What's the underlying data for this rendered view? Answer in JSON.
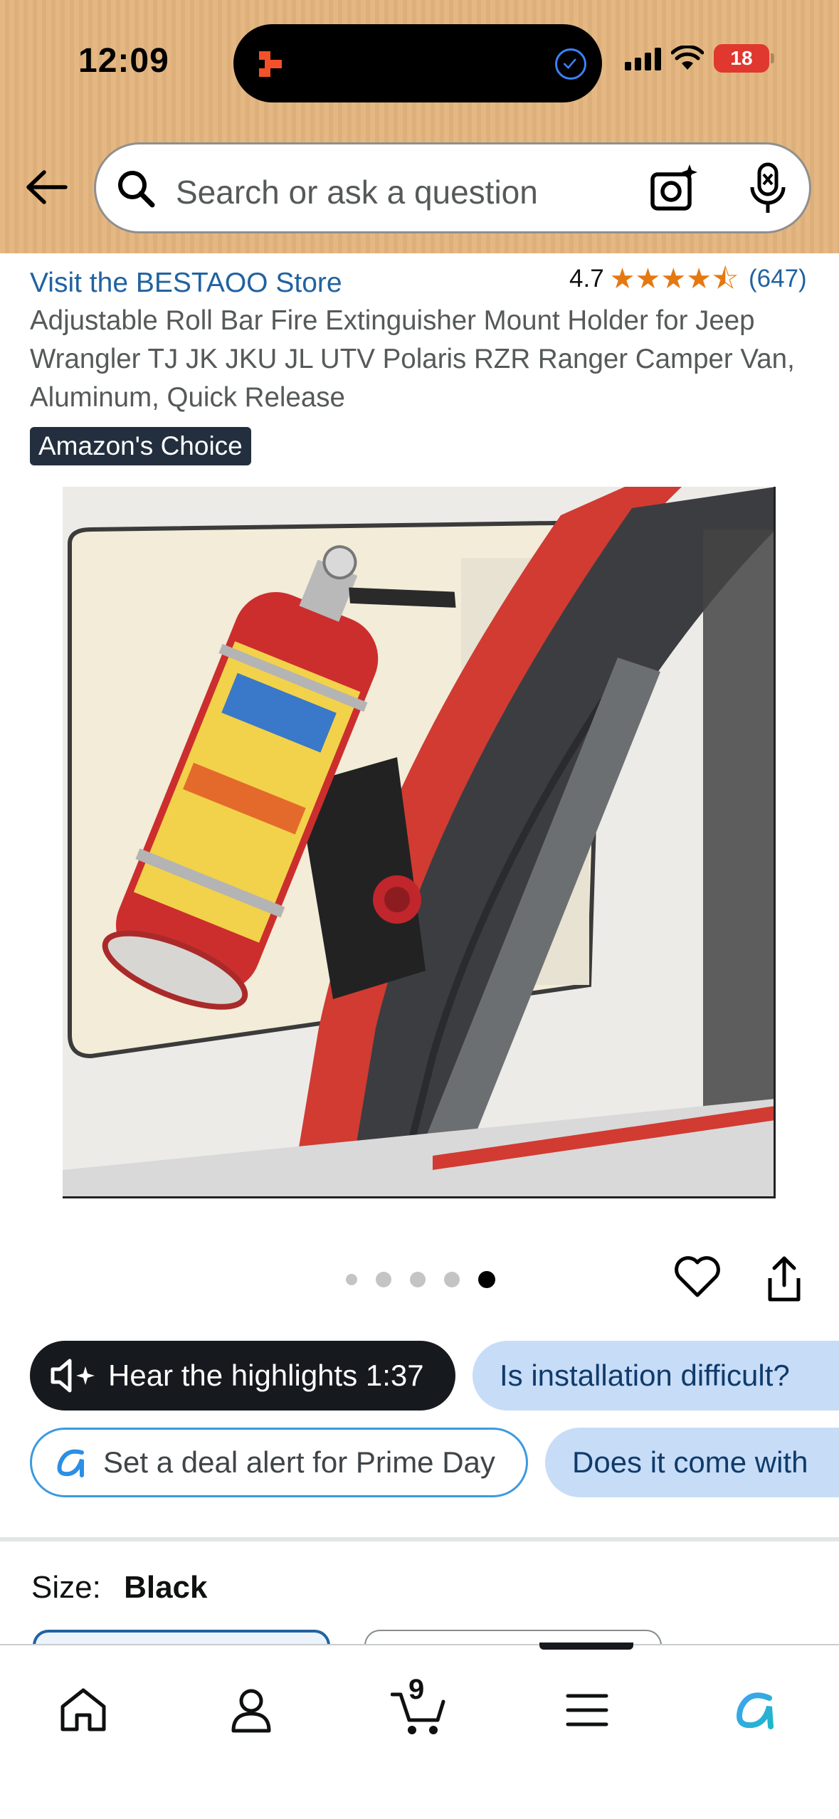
{
  "status_bar": {
    "time": "12:09",
    "battery": "18",
    "icons": [
      "app-indicator-icon",
      "check-circle-icon",
      "cellular-signal-icon",
      "wifi-icon",
      "battery-icon"
    ]
  },
  "header": {
    "back_icon": "arrow-left-icon",
    "search": {
      "placeholder": "Search or ask a question",
      "icons": [
        "search-icon",
        "camera-sparkle-icon",
        "microphone-icon"
      ]
    },
    "colors": {
      "background": "#e5b883",
      "border": "#8f8f8f"
    }
  },
  "product": {
    "store_link": "Visit the BESTAOO Store",
    "rating": "4.7",
    "stars": "★★★★⯪",
    "rating_count": "(647)",
    "title": "Adjustable Roll Bar Fire Extinguisher Mount Holder for Jeep Wrangler TJ JK JKU JL UTV Polaris RZR Ranger Camper Van, Aluminum, Quick Release",
    "badge": "Amazon's Choice",
    "image_description_icon": "product-photo",
    "image_count": 5,
    "active_image_index": 5,
    "actions": {
      "favorite_icon": "heart-icon",
      "share_icon": "share-icon"
    }
  },
  "chips": {
    "hear_highlights": "Hear the highlights 1:37",
    "question_1": "Is installation difficult?",
    "deal_alert": "Set a deal alert for Prime Day",
    "question_2": "Does it come with"
  },
  "variation": {
    "label": "Size:",
    "value": "Black"
  },
  "bottom_nav": {
    "items": [
      "home-icon",
      "account-icon",
      "cart-icon",
      "menu-icon",
      "rufus-ai-icon"
    ],
    "cart_count": "9"
  },
  "colors": {
    "link": "#2162a1",
    "star": "#e47911",
    "badge_bg": "#232f3e",
    "chip_blue": "#c7dcf7",
    "chip_dark": "#16191d"
  }
}
